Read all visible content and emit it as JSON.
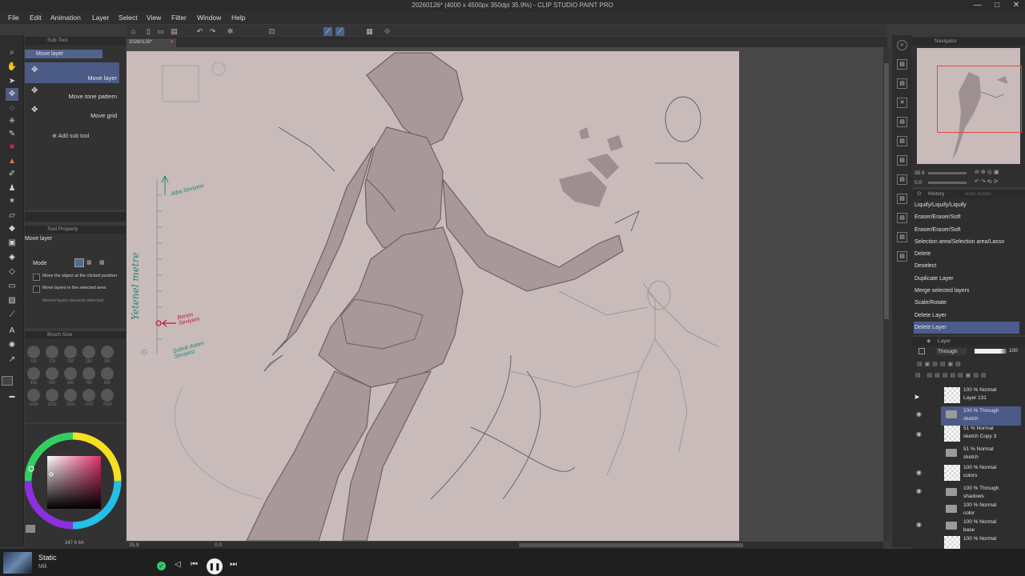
{
  "window": {
    "title": "20260126* (4000 x 4500px 350dpi 35.9%) - CLIP STUDIO PAINT PRO",
    "minimize": "—",
    "maximize": "□",
    "close": "✕"
  },
  "menu": [
    "File",
    "Edit",
    "Animation",
    "Layer",
    "Select",
    "View",
    "Filter",
    "Window",
    "Help"
  ],
  "tab": {
    "name": "20260126*",
    "close": "✕"
  },
  "subtool": {
    "panel_title": "Sub Tool",
    "group": "Move layer",
    "items": [
      "Move layer",
      "Move tone pattern",
      "Move grid"
    ],
    "add": "Add sub tool"
  },
  "tool_property": {
    "panel_title": "Tool Property",
    "tool_name": "Move layer",
    "mode_label": "Mode",
    "options": [
      "Move the object at the clicked position",
      "Move layers in the selected area",
      "Moved layers become selected"
    ]
  },
  "brush_size": {
    "panel_title": "Brush Size",
    "sizes": [
      "150",
      "170",
      "200",
      "250",
      "300",
      "400",
      "500",
      "600",
      "700",
      "800",
      "1000",
      "1200",
      "1500",
      "1700",
      "2000"
    ]
  },
  "color": {
    "accent": "#d01c6a",
    "selection": "#4c5d8d",
    "values": "347 6 64"
  },
  "canvas": {
    "annotation_green": "Yetenel metre",
    "annotation_top": "Alba Seviyesi",
    "annotation_red": "Benim Seviyem",
    "annotation_bottom": "Şubuk Adam Seviyesi"
  },
  "status": {
    "zoom": "35.9",
    "angle": "0.0"
  },
  "navigator": {
    "title": "Navigator",
    "zoom": "35.9",
    "rotate": "0.0"
  },
  "history": {
    "tab1": "History",
    "tab2": "Auto Action",
    "items": [
      "Liquify/Liquify/Liquify",
      "Eraser/Eraser/Soft",
      "Eraser/Eraser/Soft",
      "Selection area/Selection area/Lasso",
      "Delete",
      "Deselect",
      "Duplicate Layer",
      "Merge selected layers",
      "Scale/Rotate",
      "Delete Layer",
      "Delete Layer"
    ],
    "selected_index": 10
  },
  "layers": {
    "title": "Layer",
    "blend": "Through",
    "opacity": "100",
    "rows": [
      {
        "mode": "100 % Normal",
        "name": "Layer 131",
        "type": "layer"
      },
      {
        "mode": "100 % Through",
        "name": "sketch",
        "type": "folder",
        "selected": true
      },
      {
        "mode": "51 % Normal",
        "name": "sketch Copy 3",
        "type": "layer"
      },
      {
        "mode": "51 % Normal",
        "name": "sketch",
        "type": "folder"
      },
      {
        "mode": "100 % Normal",
        "name": "colors",
        "type": "layer"
      },
      {
        "mode": "100 % Through",
        "name": "shadows",
        "type": "folder"
      },
      {
        "mode": "100 % Normal",
        "name": "color",
        "type": "folder"
      },
      {
        "mode": "100 % Normal",
        "name": "base",
        "type": "folder"
      },
      {
        "mode": "100 % Normal",
        "name": "",
        "type": "layer"
      }
    ]
  },
  "media": {
    "title": "Static",
    "artist": "Mili"
  }
}
